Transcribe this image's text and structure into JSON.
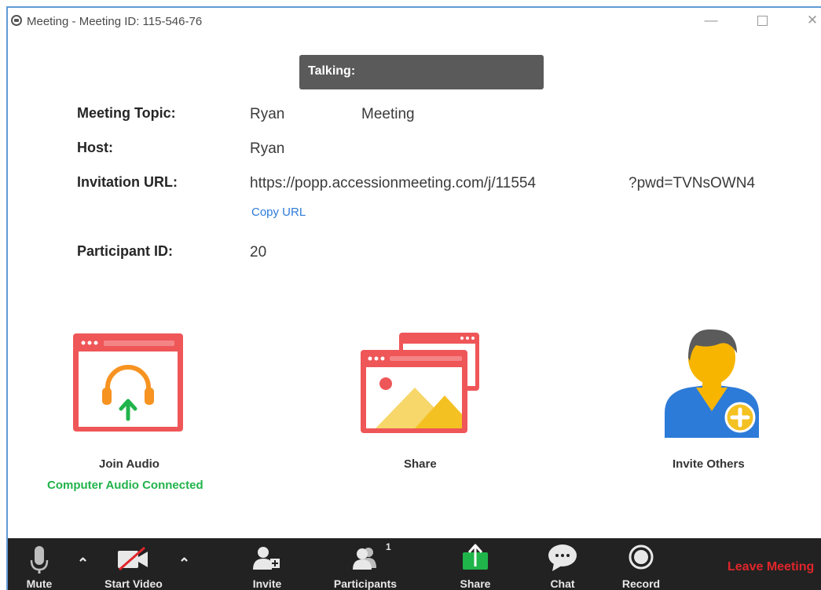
{
  "window": {
    "title": "Meeting - Meeting ID: 115-546-76",
    "minimize": "—",
    "close": "✕"
  },
  "talking": "Talking:",
  "info": {
    "topic_label": "Meeting Topic:",
    "topic_value_1": "Ryan",
    "topic_value_2": "Meeting",
    "host_label": "Host:",
    "host_value": "Ryan",
    "url_label": "Invitation URL:",
    "url_value_1": "https://popp.accessionmeeting.com/j/11554",
    "url_value_2": "?pwd=TVNsOWN4",
    "copy_url": "Copy URL",
    "participant_label": "Participant ID:",
    "participant_value": "20"
  },
  "actions": {
    "join_audio": "Join Audio",
    "audio_status": "Computer Audio Connected",
    "share": "Share",
    "invite_others": "Invite Others"
  },
  "toolbar": {
    "mute": "Mute",
    "start_video": "Start Video",
    "invite": "Invite",
    "participants": "Participants",
    "participants_count": "1",
    "share": "Share",
    "chat": "Chat",
    "record": "Record",
    "leave": "Leave Meeting"
  },
  "colors": {
    "accent_red": "#ef5658",
    "status_green": "#21b34b",
    "link_blue": "#2d7bd8",
    "share_green": "#1fb54a",
    "leave_red": "#e0262b"
  }
}
